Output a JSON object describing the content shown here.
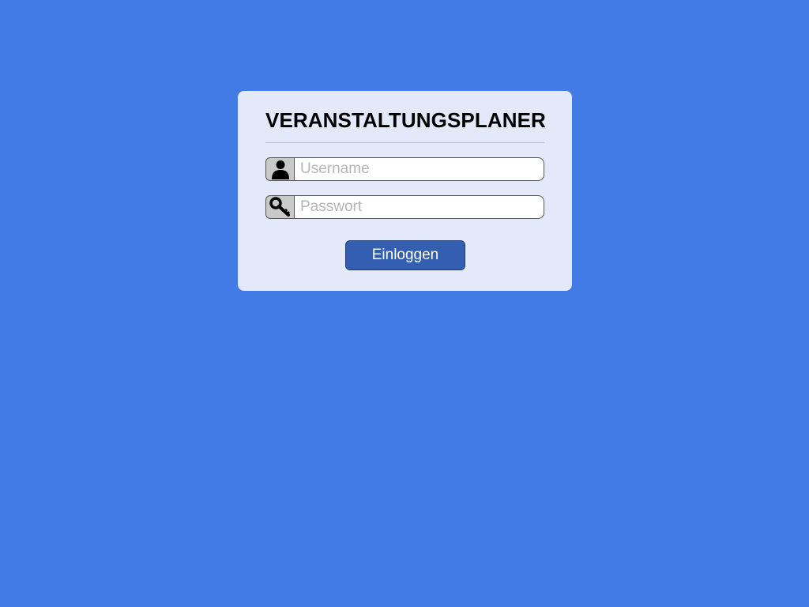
{
  "login": {
    "title": "VERANSTALTUNGSPLANER",
    "username": {
      "placeholder": "Username",
      "value": "",
      "icon": "user-icon"
    },
    "password": {
      "placeholder": "Passwort",
      "value": "",
      "icon": "key-icon"
    },
    "submit_label": "Einloggen"
  },
  "colors": {
    "background": "#427be5",
    "card": "#e3e9f8",
    "button": "#345fb0",
    "icon_box": "#c9c9c9"
  }
}
